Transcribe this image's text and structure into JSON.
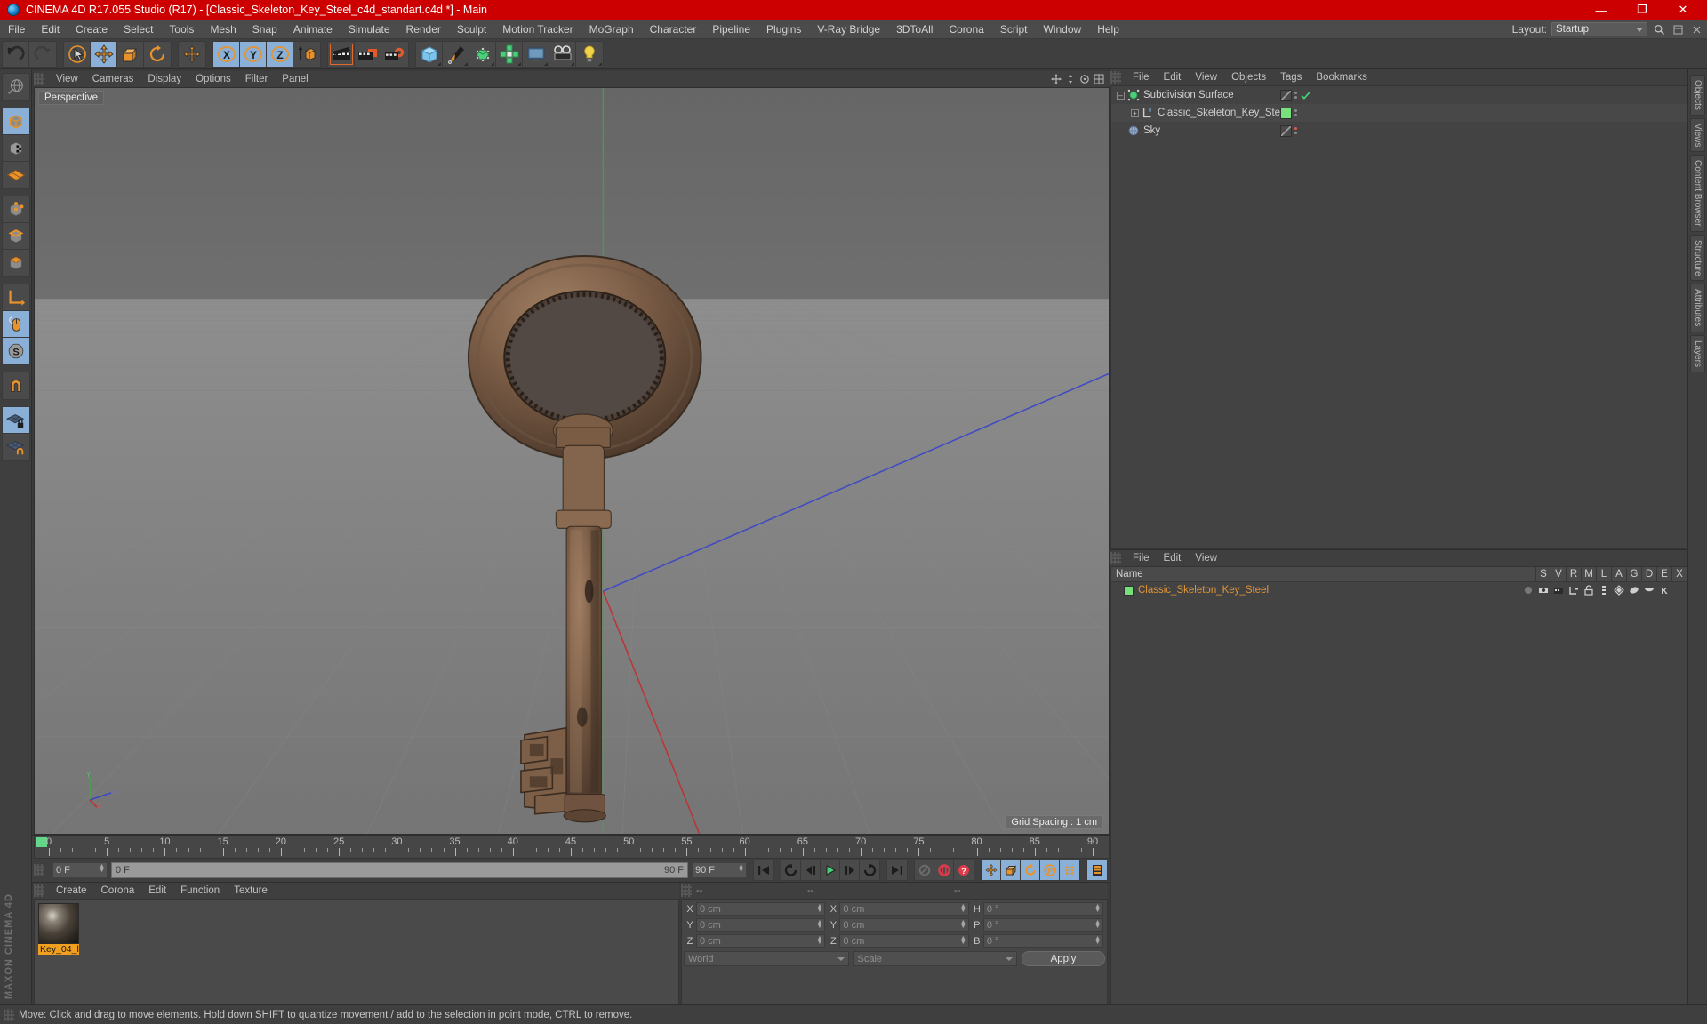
{
  "titlebar": {
    "title": "CINEMA 4D R17.055 Studio (R17) - [Classic_Skeleton_Key_Steel_c4d_standart.c4d *] - Main",
    "minimize": "—",
    "maximize": "❐",
    "close": "✕"
  },
  "menubar": {
    "items": [
      "File",
      "Edit",
      "Create",
      "Select",
      "Tools",
      "Mesh",
      "Snap",
      "Animate",
      "Simulate",
      "Render",
      "Sculpt",
      "Motion Tracker",
      "MoGraph",
      "Character",
      "Pipeline",
      "Plugins",
      "V-Ray Bridge",
      "3DToAll",
      "Corona",
      "Script",
      "Window",
      "Help"
    ],
    "layout_label": "Layout:",
    "layout_value": "Startup"
  },
  "viewport": {
    "menu": [
      "View",
      "Cameras",
      "Display",
      "Options",
      "Filter",
      "Panel"
    ],
    "label": "Perspective",
    "grid_spacing": "Grid Spacing : 1 cm",
    "axis_x": "X",
    "axis_y": "Y",
    "axis_z": "Z"
  },
  "timeline": {
    "ticks": [
      0,
      5,
      10,
      15,
      20,
      25,
      30,
      35,
      40,
      45,
      50,
      55,
      60,
      65,
      70,
      75,
      80,
      85,
      90
    ],
    "current_frame": "0 F",
    "slider_start": "0 F",
    "slider_end": "90 F",
    "range_end": "90 F",
    "end_frame_field": "0 F"
  },
  "material_manager_bottom": {
    "menu": [
      "Create",
      "Corona",
      "Edit",
      "Function",
      "Texture"
    ],
    "material_name": "Key_04_l"
  },
  "coordinates": {
    "header": [
      "--",
      "--",
      "--"
    ],
    "position": {
      "labels": [
        "X",
        "Y",
        "Z"
      ],
      "values": [
        "0 cm",
        "0 cm",
        "0 cm"
      ]
    },
    "size": {
      "labels": [
        "X",
        "Y",
        "Z"
      ],
      "values": [
        "0 cm",
        "0 cm",
        "0 cm"
      ]
    },
    "rotation": {
      "labels": [
        "H",
        "P",
        "B"
      ],
      "values": [
        "0 °",
        "0 °",
        "0 °"
      ]
    },
    "space_select": "World",
    "mode_select": "Scale",
    "apply_label": "Apply"
  },
  "object_manager": {
    "menu": [
      "File",
      "Edit",
      "View",
      "Objects",
      "Tags",
      "Bookmarks"
    ],
    "rows": [
      {
        "name": "Subdivision Surface",
        "icon": "subdivision-surface-icon",
        "indent": 0,
        "tag_color": "none",
        "check": true,
        "dot": "none"
      },
      {
        "name": "Classic_Skeleton_Key_Steel",
        "icon": "polygon-object-icon",
        "indent": 1,
        "tag_color": "#77e07a",
        "check": false,
        "dot": "none"
      },
      {
        "name": "Sky",
        "icon": "sky-icon",
        "indent": 0,
        "tag_color": "none",
        "check": false,
        "dot": "#e05a4a"
      }
    ]
  },
  "material_manager_right": {
    "menu": [
      "File",
      "Edit",
      "View"
    ],
    "columns": [
      "Name",
      "S",
      "V",
      "R",
      "M",
      "L",
      "A",
      "G",
      "D",
      "E",
      "X"
    ],
    "rows": [
      {
        "name": "Classic_Skeleton_Key_Steel",
        "swatch": "#77e07a"
      }
    ]
  },
  "right_rail": {
    "tabs": [
      "Objects",
      "Views",
      "Content Browser",
      "Structure",
      "Attributes",
      "Layers"
    ]
  },
  "statusbar": {
    "message": "Move: Click and drag to move elements. Hold down SHIFT to quantize movement / add to the selection in point mode, CTRL to remove."
  },
  "branding": {
    "maxon": "MAXON",
    "product": "CINEMA 4D"
  },
  "colors": {
    "title_red": "#cc0000",
    "accent_orange": "#e8922b",
    "selection_blue": "#8ab0d8",
    "green": "#77e07a"
  }
}
